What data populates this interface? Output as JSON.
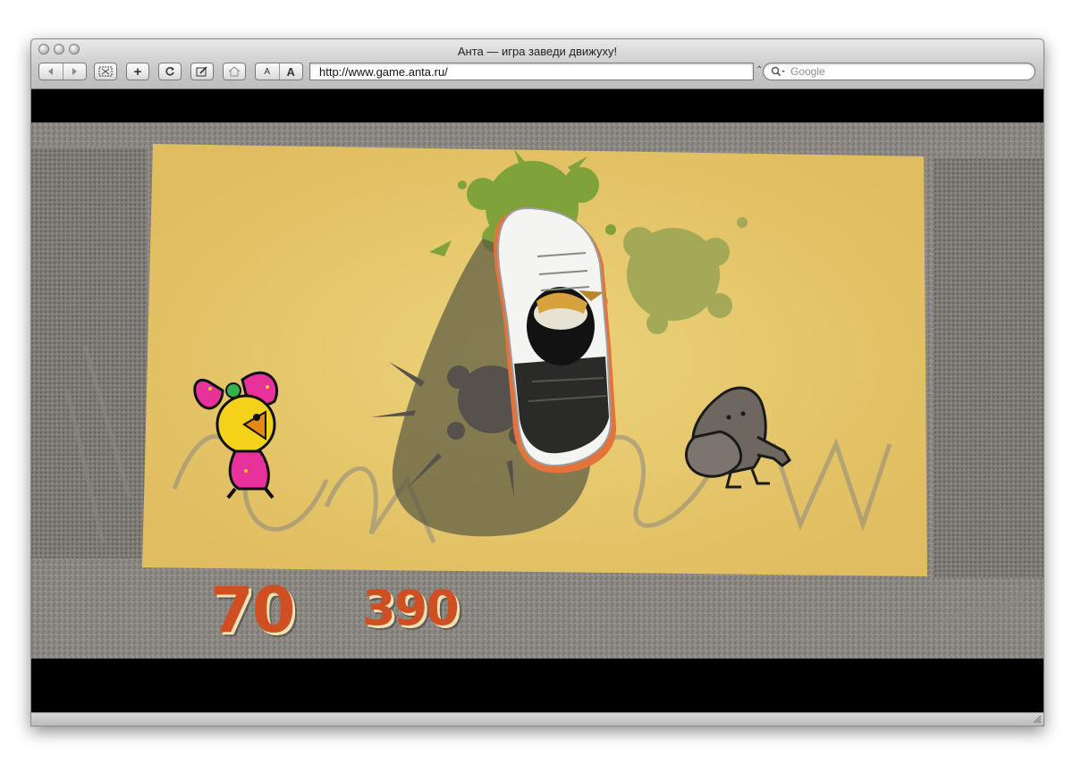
{
  "window": {
    "title": "Анта — игра заведи движуху!"
  },
  "toolbar": {
    "back_icon": "back-arrow-icon",
    "forward_icon": "forward-arrow-icon",
    "url": "http://www.game.anta.ru/",
    "search_placeholder": "Google",
    "text_smaller": "A",
    "text_bigger": "A"
  },
  "game": {
    "score_left": "70",
    "score_right": "390",
    "colors": {
      "mat": "#e8c86a",
      "score": "#cf4f22",
      "splat_green": "#7fa23a",
      "splat_olive": "#a3a957"
    }
  }
}
